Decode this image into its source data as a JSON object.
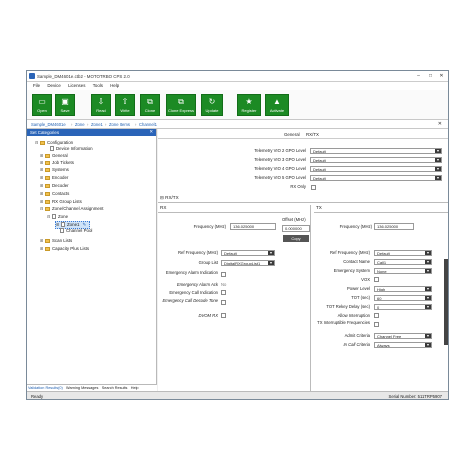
{
  "window": {
    "title": "Sample_DM4601e.ctb2 - MOTOTRBO CPS 2.0",
    "minimize": "–",
    "maximize": "□",
    "close": "✕"
  },
  "menu": [
    "File",
    "Device",
    "Licenses",
    "Tools",
    "Help"
  ],
  "toolbar": [
    {
      "label": "Open",
      "icon": "folder-icon"
    },
    {
      "label": "Save",
      "icon": "save-icon"
    },
    {
      "label": "Read",
      "icon": "read-icon"
    },
    {
      "label": "Write",
      "icon": "write-icon"
    },
    {
      "label": "Clone",
      "icon": "clone-icon"
    },
    {
      "label": "Clone Express",
      "icon": "clone-express-icon"
    },
    {
      "label": "Update",
      "icon": "update-icon"
    },
    {
      "label": "Register",
      "icon": "register-icon"
    },
    {
      "label": "Activate",
      "icon": "activate-icon"
    }
  ],
  "breadcrumb": [
    "Sample_DM4601e",
    "Zone",
    "Zone1",
    "Zone Items",
    "Channel1"
  ],
  "left_pane": {
    "header": "Set Categories",
    "tree": [
      "Configuration",
      "Device Information",
      "General",
      "Job Tickets",
      "Systems",
      "Encoder",
      "Decoder",
      "Contacts",
      "RX Group Lists",
      "Zone/Channel Assignment",
      "Zone",
      "Zone1",
      "Channel Pool",
      "Scan Lists",
      "Capacity Plus Lists"
    ]
  },
  "bottom_tabs": [
    "Validation Results(0)",
    "Warning Messages",
    "Search Results",
    "Help"
  ],
  "status": {
    "left": "Ready",
    "right": "Serial Number: 511TRP5907"
  },
  "right_pane": {
    "tabs": [
      "General",
      "RX/TX"
    ],
    "telemetry": [
      {
        "label": "Telemetry VIO 2 GPO Level",
        "value": "Default"
      },
      {
        "label": "Telemetry VIO 3 GPO Level",
        "value": "Default"
      },
      {
        "label": "Telemetry VIO 4 GPO Level",
        "value": "Default"
      },
      {
        "label": "Telemetry VIO 5 GPO Level",
        "value": "Default"
      }
    ],
    "rx_only_label": "RX Only",
    "section_title": "RX/TX",
    "rx_header": "RX",
    "tx_header": "TX",
    "rx_freq_label": "Frequency (MHz)",
    "rx_freq_value": "136.025000",
    "offset_label": "Offset (MHz)",
    "offset_value": "0.000000",
    "copy_label": "Copy",
    "tx_freq_label": "Frequency (MHz)",
    "tx_freq_value": "136.025000",
    "rx_fields": [
      {
        "label": "Ref Frequency (MHz)",
        "value": "Default",
        "kind": "dd"
      },
      {
        "label": "Group List",
        "value": "DigitalRXGroupList1",
        "kind": "dd"
      },
      {
        "label": "Emergency Alarm Indication",
        "kind": "chk"
      },
      {
        "label": "Emergency Alarm Ack",
        "value": "No",
        "kind": "text"
      },
      {
        "label": "Emergency Call Indication",
        "kind": "chk"
      },
      {
        "label": "Emergency Call Decode Tone",
        "kind": "chk"
      },
      {
        "label": "DVOM RX",
        "kind": "chk"
      }
    ],
    "tx_fields": [
      {
        "label": "Ref Frequency (MHz)",
        "value": "Default",
        "kind": "dd"
      },
      {
        "label": "Contact Name",
        "value": "Call1",
        "kind": "dd"
      },
      {
        "label": "Emergency System",
        "value": "None",
        "kind": "dd"
      },
      {
        "label": "VOX",
        "kind": "chk"
      },
      {
        "label": "Power Level",
        "value": "High",
        "kind": "dd"
      },
      {
        "label": "TOT (sec)",
        "value": "60",
        "kind": "dd"
      },
      {
        "label": "TOT Rekey Delay (sec)",
        "value": "0",
        "kind": "dd"
      },
      {
        "label": "Allow Interruption",
        "kind": "chk"
      },
      {
        "label": "TX Interruptible Frequencies",
        "kind": "chk"
      },
      {
        "label": "Admit Criteria",
        "value": "Channel Free",
        "kind": "dd"
      },
      {
        "label": "In Call Criteria",
        "value": "Always",
        "kind": "dd"
      }
    ]
  }
}
